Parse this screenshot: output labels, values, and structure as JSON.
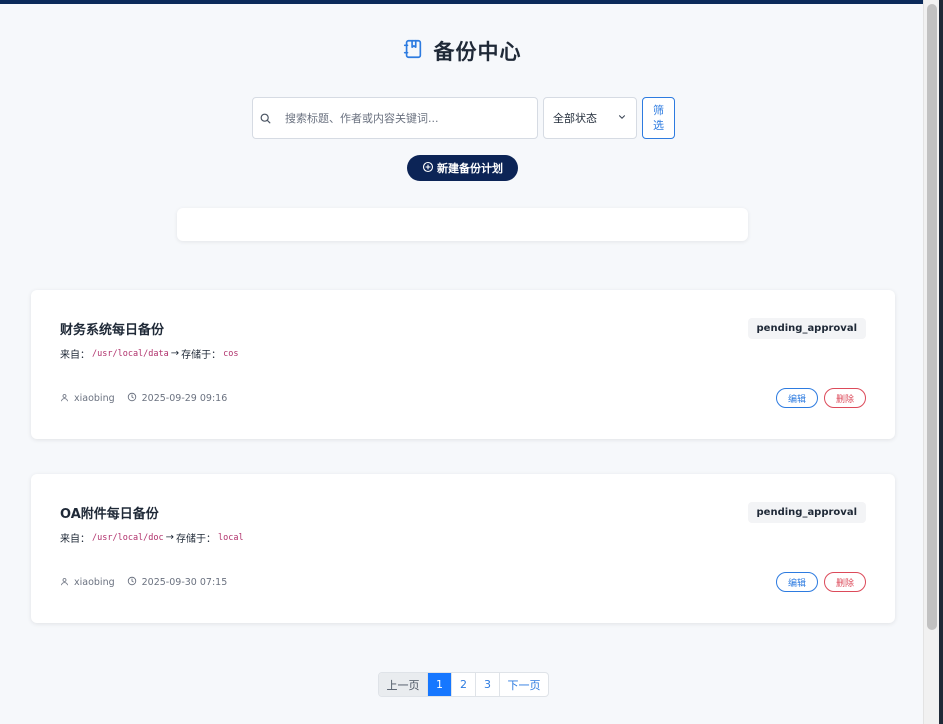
{
  "header": {
    "title": "备份中心"
  },
  "search": {
    "placeholder": "搜索标题、作者或内容关键词..."
  },
  "filter": {
    "status_selected": "全部状态",
    "button_label": "筛选"
  },
  "actions": {
    "new_plan_label": "新建备份计划"
  },
  "labels": {
    "from": "来自：",
    "arrow": "→",
    "stored_in": "存储于：",
    "edit": "编辑",
    "delete": "删除"
  },
  "cards": [
    {
      "title": "财务系统每日备份",
      "source_path": "/usr/local/data",
      "storage": "cos",
      "status": "pending_approval",
      "author": "xiaobing",
      "time": "2025-09-29 09:16"
    },
    {
      "title": "OA附件每日备份",
      "source_path": "/usr/local/doc",
      "storage": "local",
      "status": "pending_approval",
      "author": "xiaobing",
      "time": "2025-09-30 07:15"
    }
  ],
  "pagination": {
    "prev": "上一页",
    "pages": [
      "1",
      "2",
      "3"
    ],
    "active": "1",
    "next": "下一页"
  },
  "colors": {
    "primary": "#1677ff",
    "navy": "#0c2456",
    "danger": "#dc4a5a",
    "accent": "#2d7be0"
  }
}
